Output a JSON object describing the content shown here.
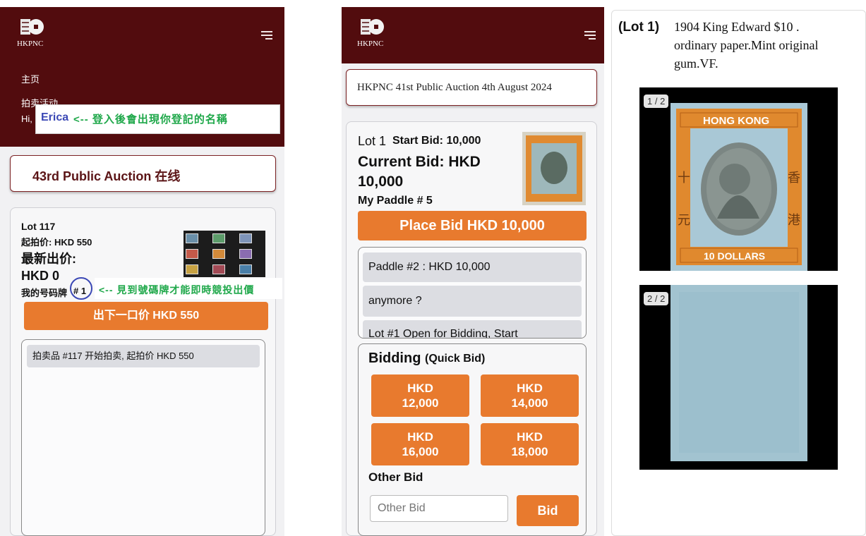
{
  "brand": {
    "logo_text": "HKPNC"
  },
  "left": {
    "nav": [
      "主页",
      "拍卖活动"
    ],
    "greeting": "Hi,",
    "user_name": "Erica",
    "login_note": "<-- 登入後會出現你登記的名稱",
    "auction_title": "43rd Public Auction 在线",
    "lot_label": "Lot 117",
    "start_bid": "起拍价: HKD 550",
    "latest_bid_label": "最新出价:",
    "latest_bid_value": "HKD 0",
    "paddle_label": "我的号码牌",
    "paddle_number": "# 1",
    "paddle_note": "<-- 見到號碼牌才能即時競投出價",
    "bid_button": "出下一口价 HKD 550",
    "log": [
      "拍卖品 #117 开始拍卖, 起拍价 HKD 550"
    ]
  },
  "middle": {
    "auction_title": "HKPNC 41st Public Auction 4th August 2024",
    "lot": "Lot 1",
    "start_bid": "Start Bid: 10,000",
    "current_bid_line1": "Current Bid: HKD",
    "current_bid_line2": "10,000",
    "paddle": "My Paddle # 5",
    "place_bid": "Place Bid HKD 10,000",
    "log": [
      "Paddle #2 : HKD 10,000",
      "anymore ?",
      "Lot #1 Open for Bidding, Start"
    ],
    "bidding_title": "Bidding",
    "bidding_sub": "(Quick Bid)",
    "quick_bids": [
      {
        "l1": "HKD",
        "l2": "12,000"
      },
      {
        "l1": "HKD",
        "l2": "14,000"
      },
      {
        "l1": "HKD",
        "l2": "16,000"
      },
      {
        "l1": "HKD",
        "l2": "18,000"
      }
    ],
    "other_bid_label": "Other Bid",
    "other_bid_placeholder": "Other Bid",
    "bid_button": "Bid"
  },
  "right": {
    "lot_tag": "(Lot 1)",
    "desc_line1": "1904 King Edward $10 .",
    "desc_line2": "ordinary paper.Mint original",
    "desc_line3": "gum.VF.",
    "img1_counter": "1 / 2",
    "img2_counter": "2 / 2",
    "stamp_top_text": "HONG KONG",
    "stamp_bottom_text": "10 DOLLARS",
    "stamp_left_chars": "十元",
    "stamp_right_chars": "香港"
  },
  "colors": {
    "header": "#520c0e",
    "accent_orange": "#e87a2e",
    "title_red": "#5b1416",
    "name_blue": "#3b48b5",
    "note_green": "#1fa84a",
    "stamp_blue": "#a9c8d6",
    "stamp_orange": "#e0892e"
  }
}
